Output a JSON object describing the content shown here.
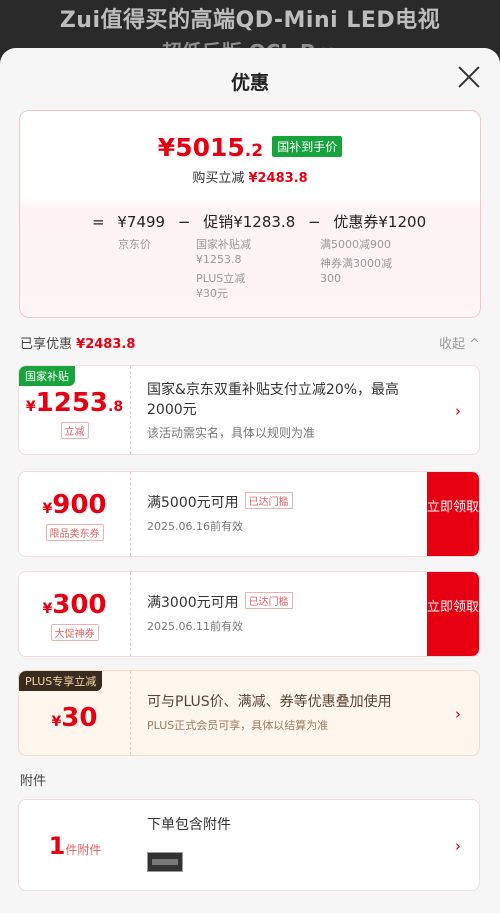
{
  "background": {
    "title": "Zui值得买的高端QD-Mini LED电视",
    "subtitle": "超低反版 QCL Pro"
  },
  "sheet": {
    "title": "优惠",
    "close_icon": "close-icon"
  },
  "summary": {
    "currency": "¥",
    "price_main": "5015",
    "price_decimal": ".2",
    "price_tag": "国补到手价",
    "buy_save_label": "购买立减",
    "buy_save_value": "¥2483.8",
    "calc": {
      "eq": "=",
      "jd_price": "¥7499",
      "minus1": "−",
      "promo": "促销¥1283.8",
      "minus2": "−",
      "coupon": "优惠券¥1200"
    },
    "col1": [
      "京东价"
    ],
    "col2": [
      "国家补贴减",
      "¥1253.8",
      "PLUS立减",
      "¥30元"
    ],
    "col3": [
      "满5000减900",
      "神券满3000减",
      "300"
    ]
  },
  "applied": {
    "label": "已享优惠",
    "value": "¥2483.8",
    "collapse": "收起 ^"
  },
  "cards": [
    {
      "corner": "国家补贴",
      "currency": "¥",
      "amount": "1253",
      "decimal": ".8",
      "sub": "立减",
      "line1": "国家&京东双重补贴支付立减20%，最高2000元",
      "line2": "该活动需实名，具体以规则为准",
      "arrow": "›"
    },
    {
      "currency": "¥",
      "amount": "900",
      "sub": "限品类东券",
      "line1": "满5000元可用",
      "threshold": "已达门槛",
      "line2": "2025.06.16前有效",
      "claim": "立即领取"
    },
    {
      "currency": "¥",
      "amount": "300",
      "sub": "大促神券",
      "line1": "满3000元可用",
      "threshold": "已达门槛",
      "line2": "2025.06.11前有效",
      "claim": "立即领取"
    },
    {
      "corner": "PLUS专享立减",
      "currency": "¥",
      "amount": "30",
      "line1": "可与PLUS价、满减、券等优惠叠加使用",
      "line2": "PLUS正式会员可享，具体以结算为准",
      "arrow": "›"
    }
  ],
  "attachment": {
    "section_label": "附件",
    "count": "1",
    "count_unit": "件附件",
    "line1": "下单包含附件",
    "arrow": "›"
  },
  "colors": {
    "accent": "#e60012",
    "gov_green": "#17a43d",
    "plus_dark": "#3a2b1f"
  }
}
